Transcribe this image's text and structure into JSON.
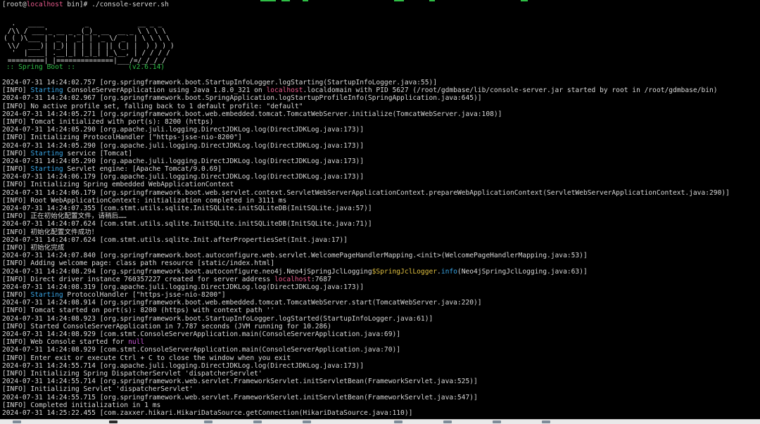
{
  "colors": {
    "background": "#000000",
    "text": "#d8d8d8",
    "info_tag": "#3aa7e8",
    "hostname": "#e85a8c",
    "spring_boot": "#2fbf46",
    "class_highlight": "#e0c040",
    "null_keyword": "#c957d8"
  },
  "prompt": {
    "user_prefix": "[root@",
    "host": "localhost",
    "suffix": " bin]# ",
    "command": "./console-server.sh"
  },
  "banner": {
    "ascii_art": "  .   ____          _            __ _ _\n /\\\\ / ___'_ __ _ _(_)_ __  __ _ \\ \\ \\ \\\n( ( )\\___ | '_ | '_| | '_ \\/ _` | \\ \\ \\ \\\n \\\\/  ___)| |_)| | | | | || (_| |  ) ) ) )\n  '  |____| .__|_| |_|_| |_\\__, | / / / /\n =========|_|==============|___/=/_/_/_/",
    "spring_boot_label": " :: Spring Boot ::             ",
    "version": "(v2.6.14)"
  },
  "log_lines": [
    {
      "segments": [
        {
          "text": "2024-07-31 14:24:02.757 [org.springframework.boot.StartupInfoLogger.logStarting(StartupInfoLogger.java:55)]",
          "style": "plain"
        }
      ]
    },
    {
      "segments": [
        {
          "text": "[INFO] ",
          "style": "plain"
        },
        {
          "text": "Starting",
          "style": "start"
        },
        {
          "text": " ConsoleServerApplication using Java 1.8.0_321 on ",
          "style": "plain"
        },
        {
          "text": "localhost",
          "style": "host"
        },
        {
          "text": ".localdomain with PID 5627 (/root/gdmbase/lib/console-server.jar started by root in /root/gdmbase/bin)",
          "style": "plain"
        }
      ]
    },
    {
      "segments": [
        {
          "text": "2024-07-31 14:24:02.967 [org.springframework.boot.SpringApplication.logStartupProfileInfo(SpringApplication.java:645)]",
          "style": "plain"
        }
      ]
    },
    {
      "segments": [
        {
          "text": "[INFO] No active profile set, falling back to 1 default profile: \"default\"",
          "style": "plain"
        }
      ]
    },
    {
      "segments": [
        {
          "text": "2024-07-31 14:24:05.271 [org.springframework.boot.web.embedded.tomcat.TomcatWebServer.initialize(TomcatWebServer.java:108)]",
          "style": "plain"
        }
      ]
    },
    {
      "segments": [
        {
          "text": "[INFO] Tomcat initialized with port(s): 8200 (https)",
          "style": "plain"
        }
      ]
    },
    {
      "segments": [
        {
          "text": "2024-07-31 14:24:05.290 [org.apache.juli.logging.DirectJDKLog.log(DirectJDKLog.java:173)]",
          "style": "plain"
        }
      ]
    },
    {
      "segments": [
        {
          "text": "[INFO] Initializing ProtocolHandler [\"https-jsse-nio-8200\"]",
          "style": "plain"
        }
      ]
    },
    {
      "segments": [
        {
          "text": "2024-07-31 14:24:05.290 [org.apache.juli.logging.DirectJDKLog.log(DirectJDKLog.java:173)]",
          "style": "plain"
        }
      ]
    },
    {
      "segments": [
        {
          "text": "[INFO] ",
          "style": "plain"
        },
        {
          "text": "Starting",
          "style": "start"
        },
        {
          "text": " service [Tomcat]",
          "style": "plain"
        }
      ]
    },
    {
      "segments": [
        {
          "text": "2024-07-31 14:24:05.290 [org.apache.juli.logging.DirectJDKLog.log(DirectJDKLog.java:173)]",
          "style": "plain"
        }
      ]
    },
    {
      "segments": [
        {
          "text": "[INFO] ",
          "style": "plain"
        },
        {
          "text": "Starting",
          "style": "start"
        },
        {
          "text": " Servlet engine: [Apache Tomcat/9.0.69]",
          "style": "plain"
        }
      ]
    },
    {
      "segments": [
        {
          "text": "2024-07-31 14:24:06.179 [org.apache.juli.logging.DirectJDKLog.log(DirectJDKLog.java:173)]",
          "style": "plain"
        }
      ]
    },
    {
      "segments": [
        {
          "text": "[INFO] Initializing Spring embedded WebApplicationContext",
          "style": "plain"
        }
      ]
    },
    {
      "segments": [
        {
          "text": "2024-07-31 14:24:06.179 [org.springframework.boot.web.servlet.context.ServletWebServerApplicationContext.prepareWebApplicationContext(ServletWebServerApplicationContext.java:290)]",
          "style": "plain"
        }
      ]
    },
    {
      "segments": [
        {
          "text": "[INFO] Root WebApplicationContext: initialization completed in 3111 ms",
          "style": "plain"
        }
      ]
    },
    {
      "segments": [
        {
          "text": "2024-07-31 14:24:07.355 [com.stmt.utils.sqlite.InitSQLite.initSQLiteDB(InitSQLite.java:57)]",
          "style": "plain"
        }
      ]
    },
    {
      "segments": [
        {
          "text": "[INFO] 正在初始化配置文件，请稍后……",
          "style": "plain"
        }
      ]
    },
    {
      "segments": [
        {
          "text": "2024-07-31 14:24:07.624 [com.stmt.utils.sqlite.InitSQLite.initSQLiteDB(InitSQLite.java:71)]",
          "style": "plain"
        }
      ]
    },
    {
      "segments": [
        {
          "text": "[INFO] 初始化配置文件成功！",
          "style": "plain"
        }
      ]
    },
    {
      "segments": [
        {
          "text": "2024-07-31 14:24:07.624 [com.stmt.utils.sqlite.Init.afterPropertiesSet(Init.java:17)]",
          "style": "plain"
        }
      ]
    },
    {
      "segments": [
        {
          "text": "[INFO] 初始化完成",
          "style": "plain"
        }
      ]
    },
    {
      "segments": [
        {
          "text": "2024-07-31 14:24:07.840 [org.springframework.boot.autoconfigure.web.servlet.WelcomePageHandlerMapping.<init>(WelcomePageHandlerMapping.java:53)]",
          "style": "plain"
        }
      ]
    },
    {
      "segments": [
        {
          "text": "[INFO] Adding welcome page: class path resource [static/index.html]",
          "style": "plain"
        }
      ]
    },
    {
      "segments": [
        {
          "text": "2024-07-31 14:24:08.294 [org.springframework.boot.autoconfigure.neo4j.Neo4jSpringJclLogging",
          "style": "plain"
        },
        {
          "text": "$SpringJclLogger",
          "style": "class"
        },
        {
          "text": ".",
          "style": "plain"
        },
        {
          "text": "info",
          "style": "method"
        },
        {
          "text": "(Neo4jSpringJclLogging.java:63)]",
          "style": "plain"
        }
      ]
    },
    {
      "segments": [
        {
          "text": "[INFO] Direct driver instance 760357227 created for server address ",
          "style": "plain"
        },
        {
          "text": "localhost",
          "style": "host"
        },
        {
          "text": ":7687",
          "style": "plain"
        }
      ]
    },
    {
      "segments": [
        {
          "text": "2024-07-31 14:24:08.319 [org.apache.juli.logging.DirectJDKLog.log(DirectJDKLog.java:173)]",
          "style": "plain"
        }
      ]
    },
    {
      "segments": [
        {
          "text": "[INFO] ",
          "style": "plain"
        },
        {
          "text": "Starting",
          "style": "start"
        },
        {
          "text": " ProtocolHandler [\"https-jsse-nio-8200\"]",
          "style": "plain"
        }
      ]
    },
    {
      "segments": [
        {
          "text": "2024-07-31 14:24:08.914 [org.springframework.boot.web.embedded.tomcat.TomcatWebServer.start(TomcatWebServer.java:220)]",
          "style": "plain"
        }
      ]
    },
    {
      "segments": [
        {
          "text": "[INFO] Tomcat started on port(s): 8200 (https) with context path ''",
          "style": "plain"
        }
      ]
    },
    {
      "segments": [
        {
          "text": "2024-07-31 14:24:08.923 [org.springframework.boot.StartupInfoLogger.logStarted(StartupInfoLogger.java:61)]",
          "style": "plain"
        }
      ]
    },
    {
      "segments": [
        {
          "text": "[INFO] Started ConsoleServerApplication in 7.787 seconds (JVM running for 10.286)",
          "style": "plain"
        }
      ]
    },
    {
      "segments": [
        {
          "text": "2024-07-31 14:24:08.929 [com.stmt.ConsoleServerApplication.main(ConsoleServerApplication.java:69)]",
          "style": "plain"
        }
      ]
    },
    {
      "segments": [
        {
          "text": "[INFO] Web Console started for ",
          "style": "plain"
        },
        {
          "text": "null",
          "style": "null"
        }
      ]
    },
    {
      "segments": [
        {
          "text": "2024-07-31 14:24:08.929 [com.stmt.ConsoleServerApplication.main(ConsoleServerApplication.java:70)]",
          "style": "plain"
        }
      ]
    },
    {
      "segments": [
        {
          "text": "[INFO] Enter exit or execute Ctrl + C to close the window when you exit",
          "style": "plain"
        }
      ]
    },
    {
      "segments": [
        {
          "text": "2024-07-31 14:24:55.714 [org.apache.juli.logging.DirectJDKLog.log(DirectJDKLog.java:173)]",
          "style": "plain"
        }
      ]
    },
    {
      "segments": [
        {
          "text": "[INFO] Initializing Spring DispatcherServlet 'dispatcherServlet'",
          "style": "plain"
        }
      ]
    },
    {
      "segments": [
        {
          "text": "2024-07-31 14:24:55.714 [org.springframework.web.servlet.FrameworkServlet.initServletBean(FrameworkServlet.java:525)]",
          "style": "plain"
        }
      ]
    },
    {
      "segments": [
        {
          "text": "[INFO] Initializing Servlet 'dispatcherServlet'",
          "style": "plain"
        }
      ]
    },
    {
      "segments": [
        {
          "text": "2024-07-31 14:24:55.715 [org.springframework.web.servlet.FrameworkServlet.initServletBean(FrameworkServlet.java:547)]",
          "style": "plain"
        }
      ]
    },
    {
      "segments": [
        {
          "text": "[INFO] Completed initialization in 1 ms",
          "style": "plain"
        }
      ]
    },
    {
      "segments": [
        {
          "text": "2024-07-31 14:25:22.455 [com.zaxxer.hikari.HikariDataSource.getConnection(HikariDataSource.java:110)]",
          "style": "plain"
        }
      ]
    }
  ]
}
